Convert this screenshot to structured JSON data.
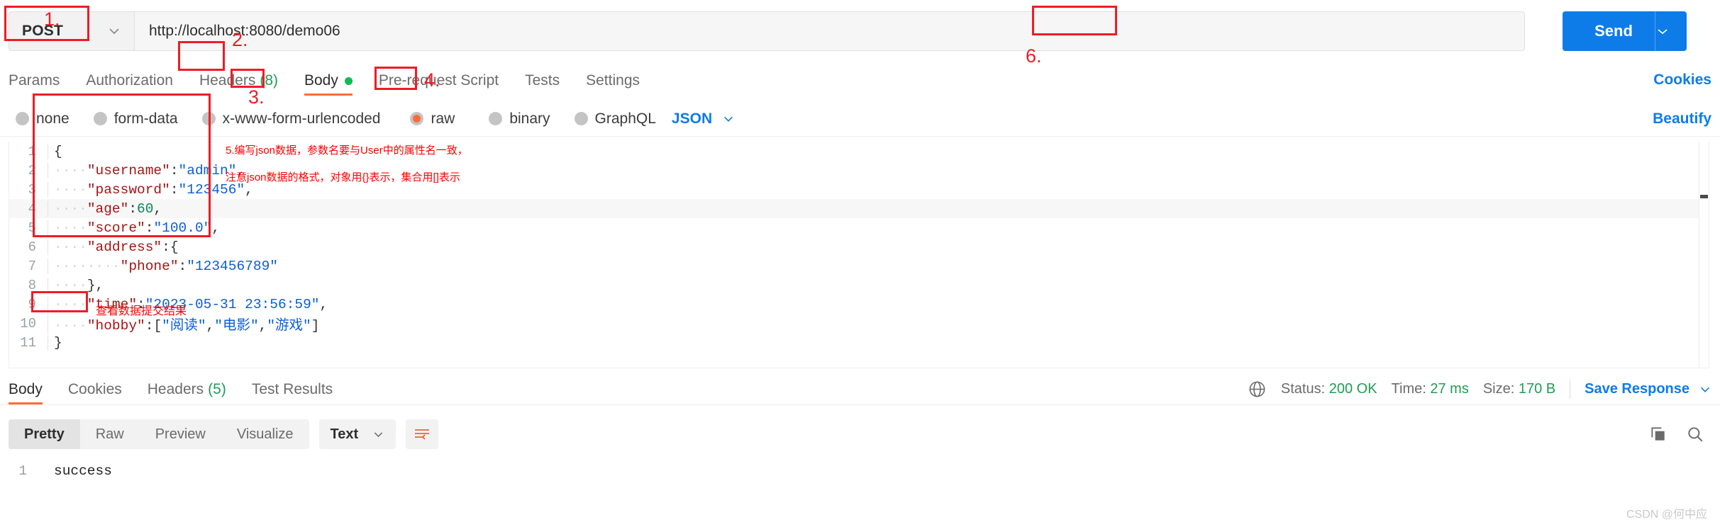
{
  "request": {
    "method": "POST",
    "url": "http://localhost:8080/demo06",
    "send_label": "Send"
  },
  "request_tabs": [
    {
      "label": "Params",
      "active": false
    },
    {
      "label": "Authorization",
      "active": false
    },
    {
      "label": "Headers",
      "count": "(8)",
      "active": false
    },
    {
      "label": "Body",
      "active": true,
      "dot": true
    },
    {
      "label": "Pre-request Script",
      "active": false
    },
    {
      "label": "Tests",
      "active": false
    },
    {
      "label": "Settings",
      "active": false
    }
  ],
  "cookies_link": "Cookies",
  "body_types": [
    {
      "label": "none",
      "selected": false
    },
    {
      "label": "form-data",
      "selected": false
    },
    {
      "label": "x-www-form-urlencoded",
      "selected": false
    },
    {
      "label": "raw",
      "selected": true
    },
    {
      "label": "binary",
      "selected": false
    },
    {
      "label": "GraphQL",
      "selected": false
    }
  ],
  "format_select": "JSON",
  "beautify_label": "Beautify",
  "editor": {
    "lines": [
      {
        "n": "1",
        "segments": [
          {
            "t": "{",
            "c": "p"
          }
        ]
      },
      {
        "n": "2",
        "segments": [
          {
            "t": "····",
            "c": "ind"
          },
          {
            "t": "\"username\"",
            "c": "k"
          },
          {
            "t": ":",
            "c": "p"
          },
          {
            "t": "\"admin\"",
            "c": "s"
          },
          {
            "t": ",",
            "c": "p"
          }
        ]
      },
      {
        "n": "3",
        "segments": [
          {
            "t": "····",
            "c": "ind"
          },
          {
            "t": "\"password\"",
            "c": "k"
          },
          {
            "t": ":",
            "c": "p"
          },
          {
            "t": "\"123456\"",
            "c": "s"
          },
          {
            "t": ",",
            "c": "p"
          }
        ]
      },
      {
        "n": "4",
        "segments": [
          {
            "t": "····",
            "c": "ind"
          },
          {
            "t": "\"age\"",
            "c": "k"
          },
          {
            "t": ":",
            "c": "p"
          },
          {
            "t": "60",
            "c": "n"
          },
          {
            "t": ",",
            "c": "p"
          }
        ]
      },
      {
        "n": "5",
        "segments": [
          {
            "t": "····",
            "c": "ind"
          },
          {
            "t": "\"score\"",
            "c": "k"
          },
          {
            "t": ":",
            "c": "p"
          },
          {
            "t": "\"100.0\"",
            "c": "s"
          },
          {
            "t": ",",
            "c": "p"
          }
        ]
      },
      {
        "n": "6",
        "segments": [
          {
            "t": "····",
            "c": "ind"
          },
          {
            "t": "\"address\"",
            "c": "k"
          },
          {
            "t": ":",
            "c": "p"
          },
          {
            "t": "{",
            "c": "p"
          }
        ]
      },
      {
        "n": "7",
        "segments": [
          {
            "t": "····",
            "c": "ind"
          },
          {
            "t": "····",
            "c": "ind"
          },
          {
            "t": "\"phone\"",
            "c": "k"
          },
          {
            "t": ":",
            "c": "p"
          },
          {
            "t": "\"123456789\"",
            "c": "s"
          }
        ]
      },
      {
        "n": "8",
        "segments": [
          {
            "t": "····",
            "c": "ind"
          },
          {
            "t": "}",
            "c": "p"
          },
          {
            "t": ",",
            "c": "p"
          }
        ]
      },
      {
        "n": "9",
        "segments": [
          {
            "t": "····",
            "c": "ind"
          },
          {
            "t": "\"time\"",
            "c": "k"
          },
          {
            "t": ":",
            "c": "p"
          },
          {
            "t": "\"2023-05-31 23:56:59\"",
            "c": "s"
          },
          {
            "t": ",",
            "c": "p"
          }
        ]
      },
      {
        "n": "10",
        "segments": [
          {
            "t": "····",
            "c": "ind"
          },
          {
            "t": "\"hobby\"",
            "c": "k"
          },
          {
            "t": ":",
            "c": "p"
          },
          {
            "t": "[",
            "c": "p"
          },
          {
            "t": "\"阅读\"",
            "c": "s"
          },
          {
            "t": ",",
            "c": "p"
          },
          {
            "t": "\"电影\"",
            "c": "s"
          },
          {
            "t": ",",
            "c": "p"
          },
          {
            "t": "\"游戏\"",
            "c": "s"
          },
          {
            "t": "]",
            "c": "p"
          }
        ]
      },
      {
        "n": "11",
        "segments": [
          {
            "t": "}",
            "c": "p"
          }
        ]
      }
    ]
  },
  "response_tabs": [
    {
      "label": "Body",
      "active": true
    },
    {
      "label": "Cookies",
      "active": false
    },
    {
      "label": "Headers",
      "count": "(5)",
      "active": false
    },
    {
      "label": "Test Results",
      "active": false
    }
  ],
  "response_meta": {
    "status_label": "Status:",
    "status_value": "200 OK",
    "time_label": "Time:",
    "time_value": "27 ms",
    "size_label": "Size:",
    "size_value": "170 B",
    "save_response": "Save Response"
  },
  "view_modes": [
    {
      "label": "Pretty",
      "active": true
    },
    {
      "label": "Raw",
      "active": false
    },
    {
      "label": "Preview",
      "active": false
    },
    {
      "label": "Visualize",
      "active": false
    }
  ],
  "response_format": "Text",
  "response_body": {
    "line_number": "1",
    "value": "success"
  },
  "annotations": {
    "n1": "1.",
    "n2": "2.",
    "n3": "3.",
    "n4": "4.",
    "n5_line1": "5.编写json数据，参数名要与User中的属性名一致，",
    "n5_line2": "注意json数据的格式，对象用{}表示，集合用[]表示",
    "n6": "6.",
    "result_note": "查看数据提交结果"
  },
  "watermark": "CSDN @何中应",
  "colors": {
    "accent_orange": "#ff6c37",
    "link_blue": "#0d7ce8",
    "annotation_red": "#ee1c25",
    "status_green": "#1f9d55"
  }
}
